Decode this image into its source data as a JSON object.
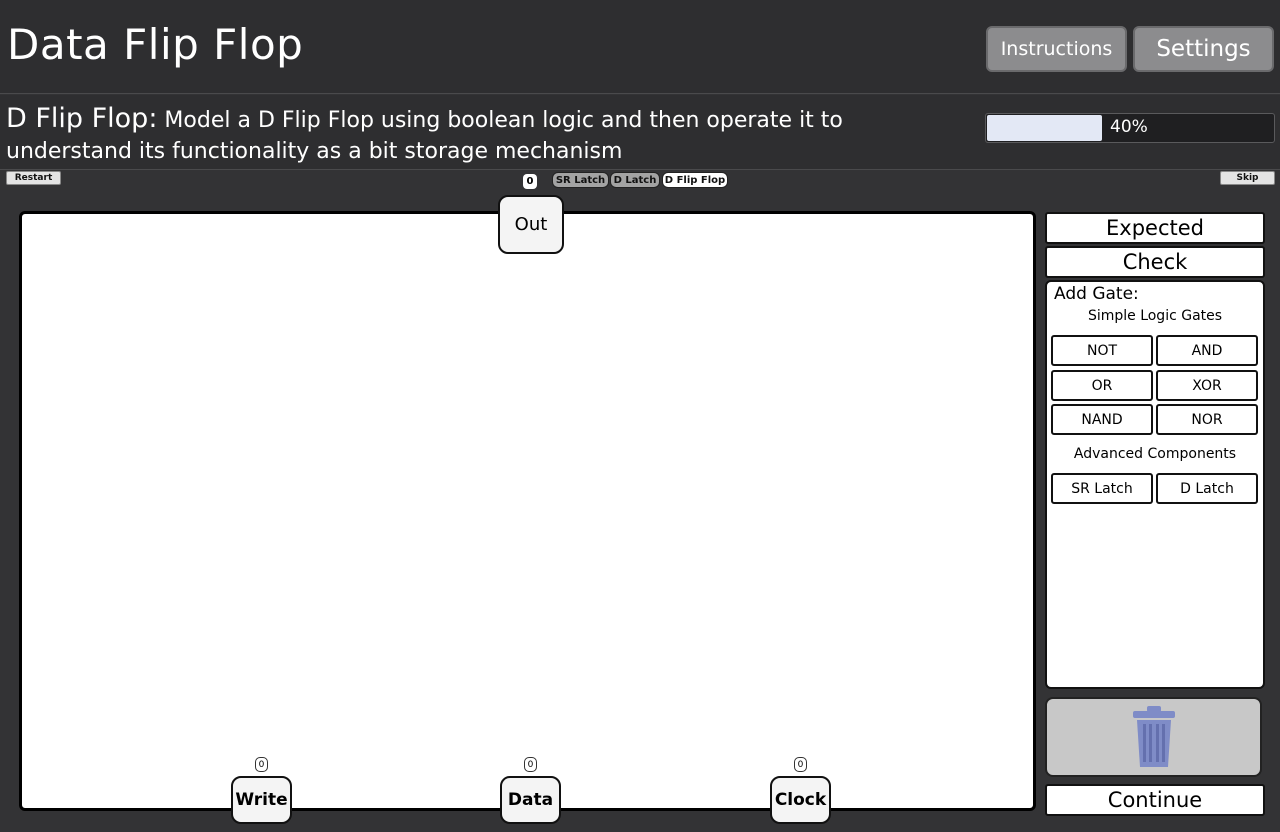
{
  "header": {
    "title": "Data Flip Flop",
    "instructions_label": "Instructions",
    "settings_label": "Settings"
  },
  "task": {
    "name": "D Flip Flop:",
    "description": "Model a D Flip Flop using boolean logic and then operate it to understand its functionality as a bit storage mechanism",
    "progress": 0.4,
    "progress_label": "40%"
  },
  "toolbar": {
    "restart_label": "Restart",
    "skip_label": "Skip",
    "level_counter": "0",
    "level_tabs": [
      "SR Latch",
      "D Latch",
      "D Flip Flop"
    ],
    "active_tab": "D Flip Flop"
  },
  "circuit": {
    "output": {
      "label": "Out"
    },
    "inputs": [
      {
        "label": "Write",
        "value": "0"
      },
      {
        "label": "Data",
        "value": "0"
      },
      {
        "label": "Clock",
        "value": "0"
      }
    ]
  },
  "sidebar": {
    "expected_label": "Expected",
    "check_label": "Check",
    "add_gate_title": "Add Gate:",
    "simple_title": "Simple Logic Gates",
    "simple_gates": [
      "NOT",
      "AND",
      "OR",
      "XOR",
      "NAND",
      "NOR"
    ],
    "advanced_title": "Advanced Components",
    "advanced_gates": [
      "SR Latch",
      "D Latch"
    ],
    "trash_icon": "trash-icon",
    "continue_label": "Continue"
  },
  "colors": {
    "background": "#333335",
    "header": "#2e2e30",
    "progress_fill": "#e3e8f5",
    "trash_icon": "#7f8cc7",
    "trash_area": "#c8c8c8"
  }
}
